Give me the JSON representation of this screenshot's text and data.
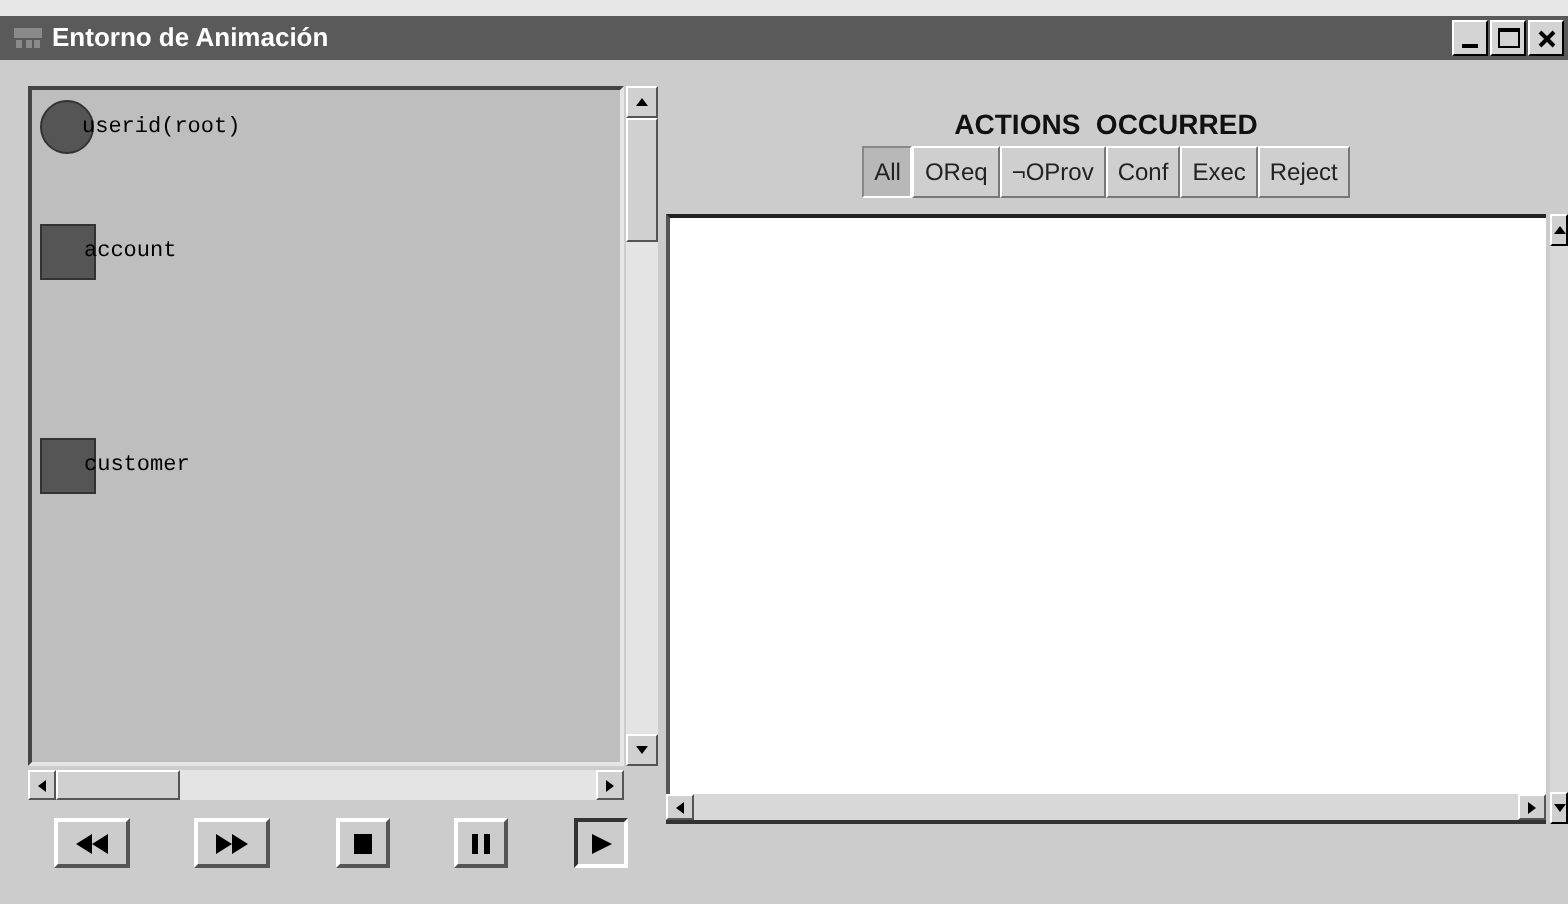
{
  "window": {
    "title": "Entorno de Animación"
  },
  "canvas": {
    "nodes": [
      {
        "label": "userid(root)",
        "kind": "circle"
      },
      {
        "label": "account",
        "kind": "square"
      },
      {
        "label": "customer",
        "kind": "square"
      }
    ]
  },
  "playback_controls": [
    {
      "kind": "rewind",
      "selected": false
    },
    {
      "kind": "fast_forward",
      "selected": false
    },
    {
      "kind": "stop",
      "selected": false
    },
    {
      "kind": "pause",
      "selected": false
    },
    {
      "kind": "play",
      "selected": true
    }
  ],
  "actions_panel": {
    "title": "ACTIONS  OCCURRED",
    "filter_tabs": [
      {
        "label": "All",
        "selected": true
      },
      {
        "label": "OReq",
        "selected": false
      },
      {
        "label": "¬OProv",
        "selected": false
      },
      {
        "label": "Conf",
        "selected": false
      },
      {
        "label": "Exec",
        "selected": false
      },
      {
        "label": "Reject",
        "selected": false
      }
    ]
  }
}
